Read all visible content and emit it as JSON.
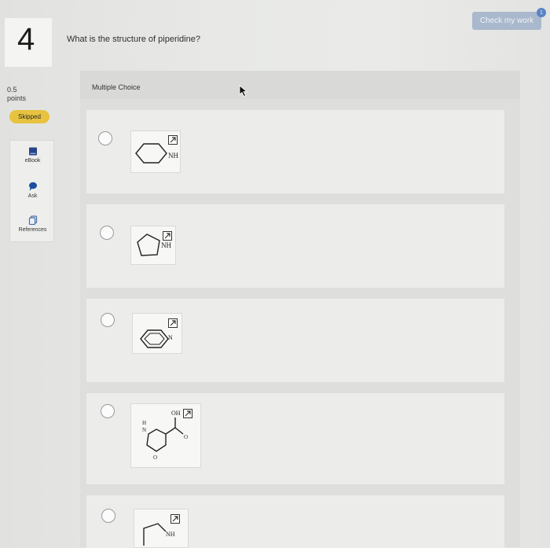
{
  "header": {
    "check_button_label": "Check my work",
    "check_badge": "1"
  },
  "question": {
    "number": "4",
    "text": "What is the structure of piperidine?",
    "points_value": "0.5",
    "points_label": "points",
    "status_badge": "Skipped"
  },
  "tools": [
    {
      "label": "eBook",
      "icon": "book-icon"
    },
    {
      "label": "Ask",
      "icon": "chat-bubble-icon"
    },
    {
      "label": "References",
      "icon": "references-icon"
    }
  ],
  "answer": {
    "type_label": "Multiple Choice",
    "options": [
      {
        "label": "NH",
        "structure": "piperidine"
      },
      {
        "label": "NH",
        "structure": "pyrrolidine"
      },
      {
        "label": "N",
        "structure": "pyridine"
      },
      {
        "labels": [
          "OH",
          "H",
          "N",
          "O",
          "O"
        ],
        "structure": "morpholine-carboxylic-acid"
      },
      {
        "label": "NH",
        "structure": "aziridine-or-small-ring"
      }
    ]
  },
  "colors": {
    "status_badge": "#e7c33f",
    "check_button": "#a9b8cc",
    "ebook_icon": "#27458a",
    "ask_icon": "#1f4ea0"
  }
}
